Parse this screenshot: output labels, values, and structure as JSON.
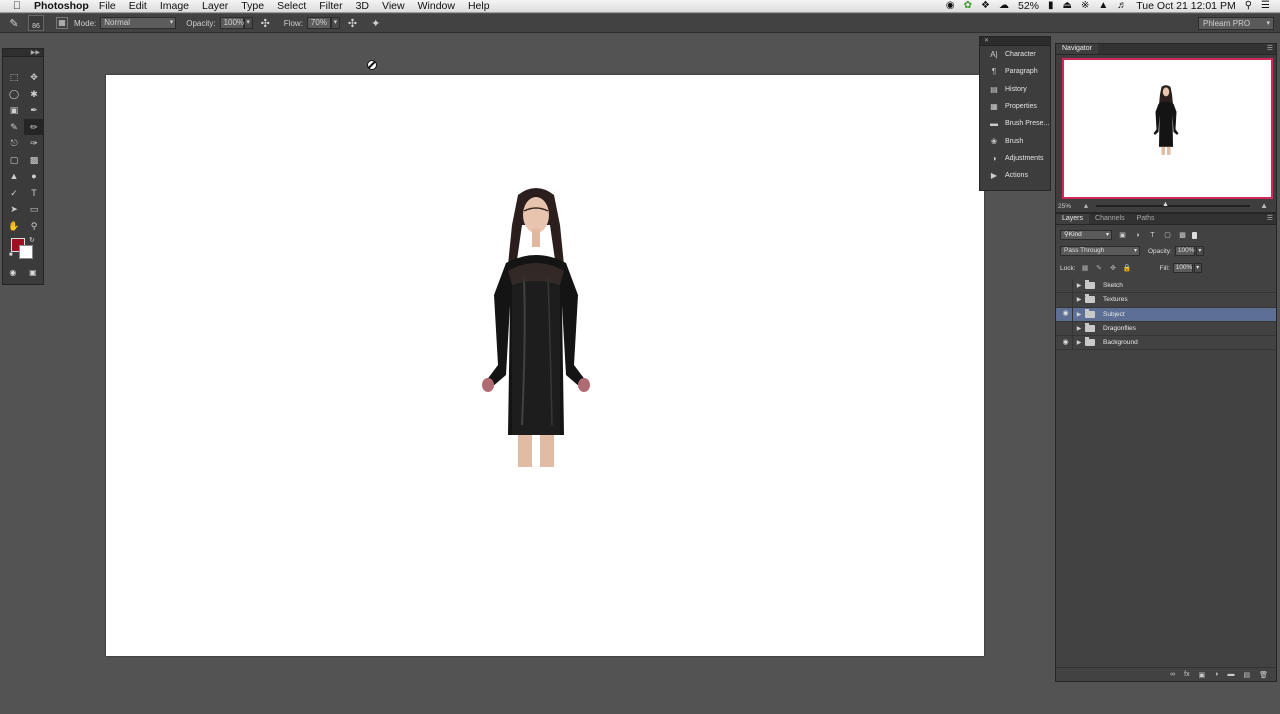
{
  "menubar": {
    "app_name": "Photoshop",
    "menus": [
      "File",
      "Edit",
      "Image",
      "Layer",
      "Type",
      "Select",
      "Filter",
      "3D",
      "View",
      "Window",
      "Help"
    ],
    "battery": "52%",
    "datetime": "Tue Oct 21  12:01 PM"
  },
  "options": {
    "brush_size": "86",
    "mode_label": "Mode:",
    "mode_value": "Normal",
    "opacity_label": "Opacity:",
    "opacity_value": "100%",
    "flow_label": "Flow:",
    "flow_value": "70%",
    "workspace": "Phlearn PRO"
  },
  "tools": {
    "foreground_color": "#a01025",
    "background_color": "#ffffff"
  },
  "side_panels": [
    {
      "label": "Character",
      "icon": "character-icon"
    },
    {
      "label": "Paragraph",
      "icon": "paragraph-icon"
    },
    {
      "label": "History",
      "icon": "history-icon"
    },
    {
      "label": "Properties",
      "icon": "properties-icon"
    },
    {
      "label": "Brush Prese...",
      "icon": "brush-presets-icon"
    },
    {
      "label": "Brush",
      "icon": "brush-icon"
    },
    {
      "label": "Adjustments",
      "icon": "adjustments-icon"
    },
    {
      "label": "Actions",
      "icon": "actions-icon"
    }
  ],
  "navigator": {
    "tab": "Navigator",
    "zoom": "25%",
    "view_box_color": "#d1285a"
  },
  "layers": {
    "tabs": [
      "Layers",
      "Channels",
      "Paths"
    ],
    "kind_filter": "Kind",
    "blend_mode": "Pass Through",
    "opacity_label": "Opacity:",
    "opacity": "100%",
    "lock_label": "Lock:",
    "fill_label": "Fill:",
    "fill": "100%",
    "items": [
      {
        "name": "Sketch",
        "visible": false,
        "selected": false
      },
      {
        "name": "Textures",
        "visible": false,
        "selected": false
      },
      {
        "name": "Subject",
        "visible": true,
        "selected": true
      },
      {
        "name": "Dragonflies",
        "visible": false,
        "selected": false
      },
      {
        "name": "Background",
        "visible": true,
        "selected": false
      }
    ],
    "selected_color": "#5d6f95"
  }
}
